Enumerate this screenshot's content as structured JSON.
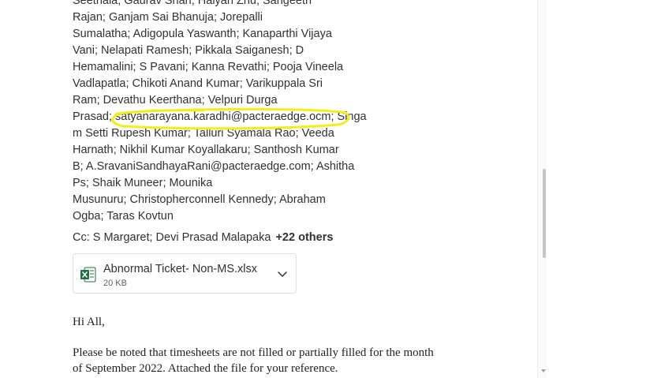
{
  "recipients": {
    "lines": [
      "Seethala;  Gaurav Shah;  Haiyan Zhu;  Sangeeth",
      "Rajan;  Ganjam Sai Bhanuja;  Jorepalli",
      "Sumalatha;  Adigopula Yaswanth;  Kanaparthi Vijaya",
      "Vani;  Nelapati Ramesh;  Pikkala Saiganesh;  D",
      "Hemamalini;  S Pavani;  Kanna Revathi;  Pooja Vineela",
      "Vadlapatla;  Chikoti Anand Kumar;  Varikuppala Sri",
      "Ram;  Devathu Keerthana;  Velpuri Durga",
      "Prasad;  satyanarayana.karadhi@pacteraedge.ocm;  Singa",
      "m Setti Rupesh Kumar;  Talluri Syamala Rao;  Veeda",
      "Harnath;  Nikhil Kumar Koyallakaru;  Santhosh Kumar",
      "B;  A.SravaniSandhayaRani@pacteraedge.com;  Ashitha",
      "Ps;  Shaik Muneer;  Mounika",
      "Musunuru;  Christophercοnnell Kennedy;  Abraham",
      "Ogba;  Taras Kovtun"
    ]
  },
  "cc": {
    "label": "Cc:",
    "names": "S Margaret;  Devi Prasad Malapaka",
    "more": "+22 others"
  },
  "attachment": {
    "filename": "Abnormal Ticket- Non-MS.xlsx",
    "size": "20 KB",
    "icon": "excel-file-icon"
  },
  "body": {
    "greeting": "Hi All,",
    "line1": "Please be noted that timesheets are not filled or partially filled for the month",
    "line2": "of September 2022. Attached the file for your reference."
  },
  "colors": {
    "highlight": "#f2ee1a",
    "excel_green": "#1d6f42",
    "text": "#323130"
  }
}
